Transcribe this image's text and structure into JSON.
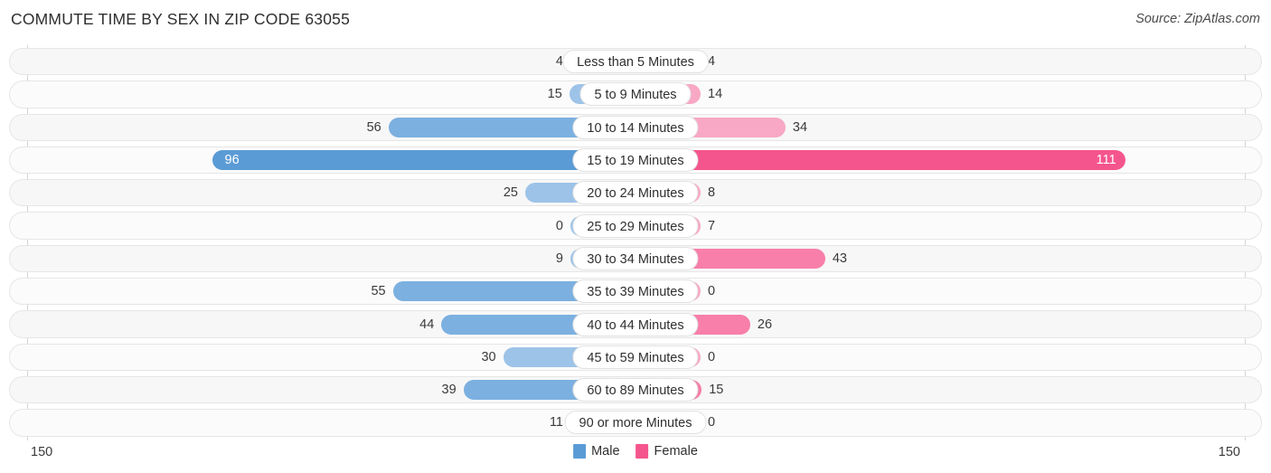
{
  "header": {
    "title": "COMMUTE TIME BY SEX IN ZIP CODE 63055",
    "source": "Source: ZipAtlas.com"
  },
  "legend": {
    "items": [
      {
        "label": "Male",
        "color": "#5b9bd5"
      },
      {
        "label": "Female",
        "color": "#f4558c"
      }
    ]
  },
  "axis": {
    "left_max": "150",
    "right_max": "150"
  },
  "chart_data": {
    "type": "bar",
    "orientation": "horizontal-diverging",
    "title": "COMMUTE TIME BY SEX IN ZIP CODE 63055",
    "xlabel": "",
    "ylabel": "",
    "xlim": [
      150,
      150
    ],
    "grid": false,
    "legend_position": "bottom-center",
    "categories": [
      "Less than 5 Minutes",
      "5 to 9 Minutes",
      "10 to 14 Minutes",
      "15 to 19 Minutes",
      "20 to 24 Minutes",
      "25 to 29 Minutes",
      "30 to 34 Minutes",
      "35 to 39 Minutes",
      "40 to 44 Minutes",
      "45 to 59 Minutes",
      "60 to 89 Minutes",
      "90 or more Minutes"
    ],
    "series": [
      {
        "name": "Male",
        "color": "#5b9bd5",
        "values": [
          4,
          15,
          56,
          96,
          25,
          0,
          9,
          55,
          44,
          30,
          39,
          11
        ]
      },
      {
        "name": "Female",
        "color": "#f4558c",
        "values": [
          4,
          14,
          34,
          111,
          8,
          7,
          43,
          0,
          26,
          0,
          15,
          0
        ]
      }
    ]
  },
  "rows": [
    {
      "label": "Less than 5 Minutes",
      "male": "4",
      "female": "4",
      "male_v": 4,
      "female_v": 4,
      "highlight": false,
      "male_strong": false,
      "female_strong": false
    },
    {
      "label": "5 to 9 Minutes",
      "male": "15",
      "female": "14",
      "male_v": 15,
      "female_v": 14,
      "highlight": false,
      "male_strong": false,
      "female_strong": false
    },
    {
      "label": "10 to 14 Minutes",
      "male": "56",
      "female": "34",
      "male_v": 56,
      "female_v": 34,
      "highlight": false,
      "male_strong": true,
      "female_strong": false
    },
    {
      "label": "15 to 19 Minutes",
      "male": "96",
      "female": "111",
      "male_v": 96,
      "female_v": 111,
      "highlight": true,
      "male_strong": false,
      "female_strong": false
    },
    {
      "label": "20 to 24 Minutes",
      "male": "25",
      "female": "8",
      "male_v": 25,
      "female_v": 8,
      "highlight": false,
      "male_strong": false,
      "female_strong": false
    },
    {
      "label": "25 to 29 Minutes",
      "male": "0",
      "female": "7",
      "male_v": 0,
      "female_v": 7,
      "highlight": false,
      "male_strong": false,
      "female_strong": false
    },
    {
      "label": "30 to 34 Minutes",
      "male": "9",
      "female": "43",
      "male_v": 9,
      "female_v": 43,
      "highlight": false,
      "male_strong": false,
      "female_strong": true
    },
    {
      "label": "35 to 39 Minutes",
      "male": "55",
      "female": "0",
      "male_v": 55,
      "female_v": 0,
      "highlight": false,
      "male_strong": true,
      "female_strong": false
    },
    {
      "label": "40 to 44 Minutes",
      "male": "44",
      "female": "26",
      "male_v": 44,
      "female_v": 26,
      "highlight": false,
      "male_strong": true,
      "female_strong": true
    },
    {
      "label": "45 to 59 Minutes",
      "male": "30",
      "female": "0",
      "male_v": 30,
      "female_v": 0,
      "highlight": false,
      "male_strong": false,
      "female_strong": false
    },
    {
      "label": "60 to 89 Minutes",
      "male": "39",
      "female": "15",
      "male_v": 39,
      "female_v": 15,
      "highlight": false,
      "male_strong": true,
      "female_strong": true
    },
    {
      "label": "90 or more Minutes",
      "male": "11",
      "female": "0",
      "male_v": 11,
      "female_v": 0,
      "highlight": false,
      "male_strong": false,
      "female_strong": false
    }
  ]
}
